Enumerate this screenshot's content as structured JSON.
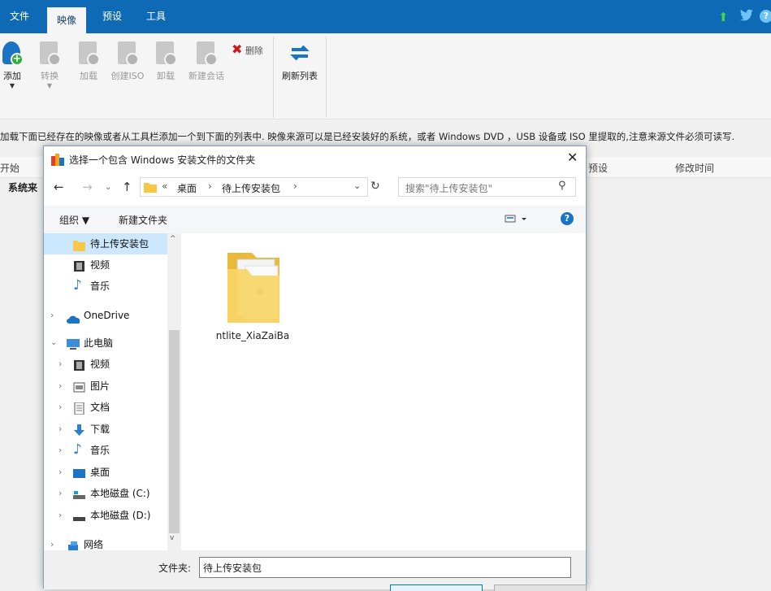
{
  "ribbon_tabs": [
    "文件",
    "映像",
    "预设",
    "工具"
  ],
  "ribbon_buttons": {
    "add": "添加",
    "convert": "转换",
    "load": "加载",
    "create_iso": "创建ISO",
    "unload": "卸载",
    "new_session": "新建会话",
    "delete": "删除",
    "refresh": "刷新列表"
  },
  "info_text": "加载下面已经存在的映像或者从工具栏添加一个到下面的列表中. 映像来源可以是已经安装好的系统，或者 Windows DVD ，USB 设备或 ISO 里提取的,注意来源文件必须可读写.",
  "list_columns": {
    "col_start": "开始",
    "col_preset": "预设",
    "col_modified": "修改时间"
  },
  "list_row_label": "系统来",
  "dialog": {
    "title": "选择一个包含 Windows 安装文件的文件夹",
    "breadcrumb": [
      "桌面",
      "待上传安装包"
    ],
    "breadcrumb_prefix": "«",
    "search_placeholder": "搜索\"待上传安装包\"",
    "organize": "组织 ▼",
    "new_folder": "新建文件夹",
    "nav_items": [
      {
        "label": "待上传安装包",
        "icon": "folder-icon",
        "selected": true
      },
      {
        "label": "视频",
        "icon": "video-icon"
      },
      {
        "label": "音乐",
        "icon": "music-icon"
      },
      {
        "label": "OneDrive",
        "icon": "cloud-icon"
      },
      {
        "label": "此电脑",
        "icon": "pc-icon"
      },
      {
        "label": "视频",
        "icon": "video-icon"
      },
      {
        "label": "图片",
        "icon": "pictures-icon"
      },
      {
        "label": "文档",
        "icon": "documents-icon"
      },
      {
        "label": "下载",
        "icon": "download-icon"
      },
      {
        "label": "音乐",
        "icon": "music-icon"
      },
      {
        "label": "桌面",
        "icon": "desktop-icon"
      },
      {
        "label": "本地磁盘 (C:)",
        "icon": "drive-icon"
      },
      {
        "label": "本地磁盘 (D:)",
        "icon": "drive-icon"
      },
      {
        "label": "网络",
        "icon": "network-icon"
      }
    ],
    "file_name": "ntlite_XiaZaiBa",
    "folder_label": "文件夹:",
    "folder_value": "待上传安装包"
  },
  "colors": {
    "accent": "#0f6ab6",
    "selection": "#cce8ff"
  }
}
